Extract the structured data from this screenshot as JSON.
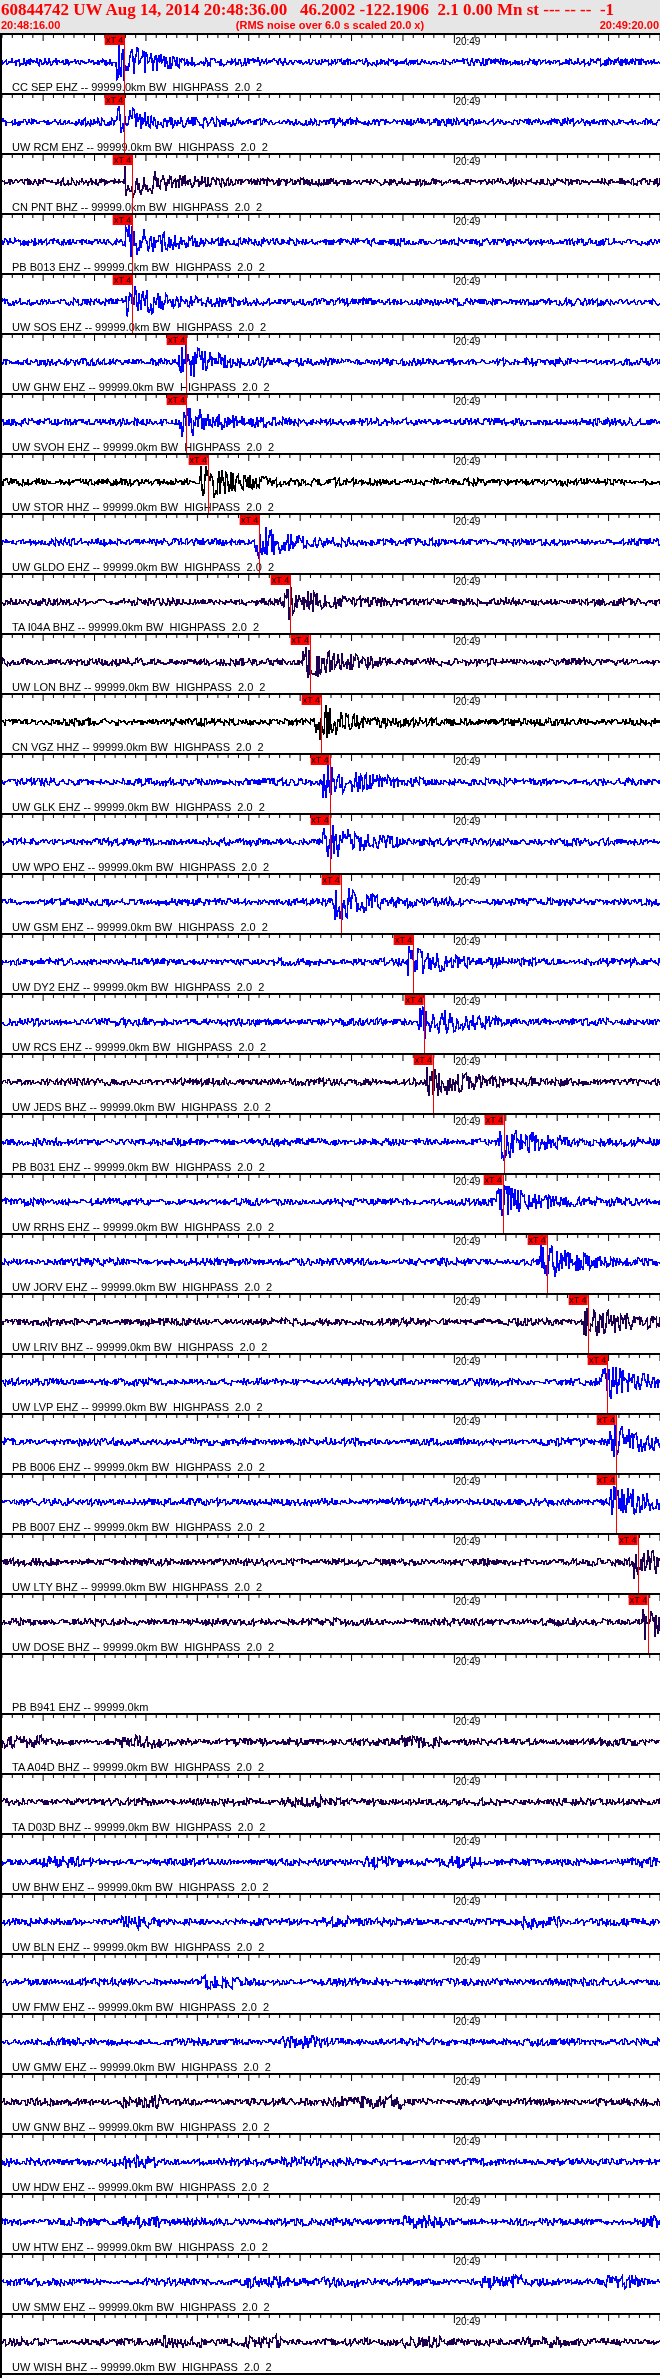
{
  "header": {
    "title": "60844742 UW Aug 14, 2014 20:48:36.00   46.2002 -122.1906  2.1 0.00 Mn st --- -- --  -1",
    "start_time": "20:48:16.00",
    "note": "(RMS noise over 6.0 s scaled 20.0 x)",
    "end_time": "20:49:20.00"
  },
  "traces": [
    {
      "label": "CC SEP EHZ -- 99999.0km BW  HIGHPASS  2.0  2",
      "time_mark": "20:49",
      "color": "#0000ff",
      "pick": {
        "text": "xT 4",
        "level": 0.186
      }
    },
    {
      "label": "UW RCM EHZ -- 99999.0km BW  HIGHPASS  2.0  2",
      "time_mark": "20:49",
      "color": "#0000ff",
      "pick": {
        "text": "xT 4",
        "level": 0.186
      }
    },
    {
      "label": "CN PNT BHZ -- 99999.0km BW  HIGHPASS  2.0  2",
      "time_mark": "20:49",
      "color": "#200050",
      "pick": {
        "text": "xT 4",
        "level": 0.198
      }
    },
    {
      "label": "PB B013 EHZ -- 99999.0km BW  HIGHPASS  2.0  2",
      "time_mark": "20:49",
      "color": "#0000ff",
      "pick": {
        "text": "xT 4",
        "level": 0.198
      }
    },
    {
      "label": "UW SOS EHZ -- 99999.0km BW  HIGHPASS  2.0  2",
      "time_mark": "20:49",
      "color": "#0000ff",
      "pick": {
        "text": "xT 4",
        "level": 0.198
      }
    },
    {
      "label": "UW GHW EHZ -- 99999.0km BW  HIGHPASS  2.0  2",
      "time_mark": "20:49",
      "color": "#0000ff",
      "pick": {
        "text": "xT 4",
        "level": 0.28
      }
    },
    {
      "label": "UW SVOH EHZ -- 99999.0km BW  HIGHPASS  2.0  2",
      "time_mark": "20:49",
      "color": "#0000ff",
      "pick": {
        "text": "xT 4",
        "level": 0.28
      }
    },
    {
      "label": "UW STOR HHZ -- 99999.0km BW  HIGHPASS  2.0  2",
      "time_mark": "20:49",
      "color": "#000000",
      "pick": {
        "text": "xT 4",
        "level": 0.313
      }
    },
    {
      "label": "UW GLDO EHZ -- 99999.0km BW  HIGHPASS  2.0  2",
      "time_mark": "20:49",
      "color": "#0000ff",
      "pick": {
        "text": "xT 4",
        "level": 0.391
      }
    },
    {
      "label": "TA I04A BHZ -- 99999.0km BW  HIGHPASS  2.0  2",
      "time_mark": "20:49",
      "color": "#200050",
      "pick": {
        "text": "xT 4",
        "level": 0.438
      }
    },
    {
      "label": "UW LON BHZ -- 99999.0km BW  HIGHPASS  2.0  2",
      "time_mark": "20:49",
      "color": "#200050",
      "pick": {
        "text": "xT 4",
        "level": 0.468
      }
    },
    {
      "label": "CN VGZ HHZ -- 99999.0km BW  HIGHPASS  2.0  2",
      "time_mark": "20:49",
      "color": "#000000",
      "pick": {
        "text": "xT 4",
        "level": 0.485
      }
    },
    {
      "label": "UW GLK EHZ -- 99999.0km BW  HIGHPASS  2.0  2",
      "time_mark": "20:49",
      "color": "#0000ff",
      "pick": {
        "text": "xT 4",
        "level": 0.498
      }
    },
    {
      "label": "UW WPO EHZ -- 99999.0km BW  HIGHPASS  2.0  2",
      "time_mark": "20:49",
      "color": "#0000ff",
      "pick": {
        "text": "xT 4",
        "level": 0.498
      }
    },
    {
      "label": "UW GSM EHZ -- 99999.0km BW  HIGHPASS  2.0  2",
      "time_mark": "20:49",
      "color": "#0000ff",
      "pick": {
        "text": "xT 4",
        "level": 0.515
      }
    },
    {
      "label": "UW DY2 EHZ -- 99999.0km BW  HIGHPASS  2.0  2",
      "time_mark": "20:49",
      "color": "#0000ff",
      "pick": {
        "text": "xT 4",
        "level": 0.625
      }
    },
    {
      "label": "UW RCS EHZ -- 99999.0km BW  HIGHPASS  2.0  2",
      "time_mark": "20:49",
      "color": "#0000ff",
      "pick": {
        "text": "xT 4",
        "level": 0.641
      }
    },
    {
      "label": "UW JEDS BHZ -- 99999.0km BW  HIGHPASS  2.0  2",
      "time_mark": "20:49",
      "color": "#200050",
      "pick": {
        "text": "xT 4",
        "level": 0.655
      }
    },
    {
      "label": "PB B031 EHZ -- 99999.0km BW  HIGHPASS  2.0  2",
      "time_mark": "20:49",
      "color": "#0000ff",
      "pick": {
        "text": "xT 4",
        "level": 0.763
      }
    },
    {
      "label": "UW RRHS EHZ -- 99999.0km BW  HIGHPASS  2.0  2",
      "time_mark": "20:49",
      "color": "#0000ff",
      "pick": {
        "text": "xT 4",
        "level": 0.761
      }
    },
    {
      "label": "UW JORV EHZ -- 99999.0km BW  HIGHPASS  2.0  2",
      "time_mark": "20:49",
      "color": "#0000ff",
      "pick": {
        "text": "xT 4",
        "level": 0.828
      }
    },
    {
      "label": "UW LRIV BHZ -- 99999.0km BW  HIGHPASS  2.0  2",
      "time_mark": "20:49",
      "color": "#200050",
      "pick": {
        "text": "xT 4",
        "level": 0.89
      }
    },
    {
      "label": "UW LVP EHZ -- 99999.0km BW  HIGHPASS  2.0  2",
      "time_mark": "20:49",
      "color": "#0000ff",
      "pick": {
        "text": "xT 4",
        "level": 0.92
      }
    },
    {
      "label": "PB B006 EHZ -- 99999.0km BW  HIGHPASS  2.0  2",
      "time_mark": "20:49",
      "color": "#0000ff",
      "pick": {
        "text": "xT 4",
        "level": 0.933
      }
    },
    {
      "label": "PB B007 EHZ -- 99999.0km BW  HIGHPASS  2.0  2",
      "time_mark": "20:49",
      "color": "#0000ff",
      "pick": {
        "text": "xT 4",
        "level": 0.933
      }
    },
    {
      "label": "UW LTY BHZ -- 99999.0km BW  HIGHPASS  2.0  2",
      "time_mark": "20:49",
      "color": "#200050",
      "pick": {
        "text": "xT 4",
        "level": 0.966
      }
    },
    {
      "label": "UW DOSE BHZ -- 99999.0km BW  HIGHPASS  2.0  2",
      "time_mark": "20:49",
      "color": "#200050",
      "pick": {
        "text": "xT 4",
        "level": 0.982
      }
    },
    {
      "label": "PB B941 EHZ -- 99999.0km",
      "time_mark": "20:49"
    },
    {
      "label": "TA A04D BHZ -- 99999.0km BW  HIGHPASS  2.0  2",
      "time_mark": "20:49",
      "color": "#200050"
    },
    {
      "label": "TA D03D BHZ -- 99999.0km BW  HIGHPASS  2.0  2",
      "time_mark": "20:49",
      "color": "#200050"
    },
    {
      "label": "UW BHW EHZ -- 99999.0km BW  HIGHPASS  2.0  2",
      "time_mark": "20:49",
      "color": "#0000ff"
    },
    {
      "label": "UW BLN EHZ -- 99999.0km BW  HIGHPASS  2.0  2",
      "time_mark": "20:49",
      "color": "#0000ff"
    },
    {
      "label": "UW FMW EHZ -- 99999.0km BW  HIGHPASS  2.0  2",
      "time_mark": "20:49",
      "color": "#0000ff"
    },
    {
      "label": "UW GMW EHZ -- 99999.0km BW  HIGHPASS  2.0  2",
      "time_mark": "20:49",
      "color": "#0000ff"
    },
    {
      "label": "UW GNW BHZ -- 99999.0km BW  HIGHPASS  2.0  2",
      "time_mark": "20:49",
      "color": "#200050"
    },
    {
      "label": "UW HDW EHZ -- 99999.0km BW  HIGHPASS  2.0  2",
      "time_mark": "20:49",
      "color": "#0000ff"
    },
    {
      "label": "UW HTW EHZ -- 99999.0km BW  HIGHPASS  2.0  2",
      "time_mark": "20:49",
      "color": "#0000ff"
    },
    {
      "label": "UW SMW EHZ -- 99999.0km BW  HIGHPASS  2.0  2",
      "time_mark": "20:49",
      "color": "#0000ff"
    },
    {
      "label": "UW WISH BHZ -- 99999.0km BW  HIGHPASS  2.0  2",
      "time_mark": "20:49",
      "color": "#200050"
    }
  ]
}
